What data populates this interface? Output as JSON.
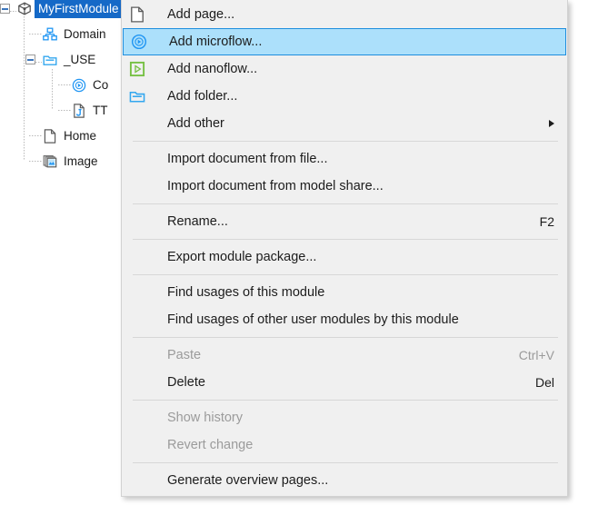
{
  "tree": {
    "items": [
      {
        "label": "MyFirstModule",
        "icon": "module-icon",
        "selected": true,
        "indent": 0,
        "expander": true
      },
      {
        "label": "Domain",
        "icon": "domain-model-icon",
        "selected": false,
        "indent": 1,
        "expander": false
      },
      {
        "label": "_USE",
        "icon": "folder-icon",
        "selected": false,
        "indent": 1,
        "expander": true
      },
      {
        "label": "Co",
        "icon": "microflow-icon",
        "selected": false,
        "indent": 2,
        "expander": false
      },
      {
        "label": "TT",
        "icon": "javascript-action-icon",
        "selected": false,
        "indent": 2,
        "expander": false
      },
      {
        "label": "Home",
        "icon": "page-icon",
        "selected": false,
        "indent": 1,
        "expander": false
      },
      {
        "label": "Image",
        "icon": "image-collection-icon",
        "selected": false,
        "indent": 1,
        "expander": false
      }
    ]
  },
  "context_menu": {
    "groups": [
      {
        "items": [
          {
            "label": "Add page...",
            "icon": "page-icon",
            "shortcut": "",
            "disabled": false,
            "highlighted": false,
            "submenu": false
          },
          {
            "label": "Add microflow...",
            "icon": "microflow-icon",
            "shortcut": "",
            "disabled": false,
            "highlighted": true,
            "submenu": false
          },
          {
            "label": "Add nanoflow...",
            "icon": "nanoflow-icon",
            "shortcut": "",
            "disabled": false,
            "highlighted": false,
            "submenu": false
          },
          {
            "label": "Add folder...",
            "icon": "folder-icon",
            "shortcut": "",
            "disabled": false,
            "highlighted": false,
            "submenu": false
          },
          {
            "label": "Add other",
            "icon": "",
            "shortcut": "",
            "disabled": false,
            "highlighted": false,
            "submenu": true
          }
        ]
      },
      {
        "items": [
          {
            "label": "Import document from file...",
            "icon": "",
            "shortcut": "",
            "disabled": false,
            "highlighted": false,
            "submenu": false
          },
          {
            "label": "Import document from model share...",
            "icon": "",
            "shortcut": "",
            "disabled": false,
            "highlighted": false,
            "submenu": false
          }
        ]
      },
      {
        "items": [
          {
            "label": "Rename...",
            "icon": "",
            "shortcut": "F2",
            "disabled": false,
            "highlighted": false,
            "submenu": false
          }
        ]
      },
      {
        "items": [
          {
            "label": "Export module package...",
            "icon": "",
            "shortcut": "",
            "disabled": false,
            "highlighted": false,
            "submenu": false
          }
        ]
      },
      {
        "items": [
          {
            "label": "Find usages of this module",
            "icon": "",
            "shortcut": "",
            "disabled": false,
            "highlighted": false,
            "submenu": false
          },
          {
            "label": "Find usages of other user modules by this module",
            "icon": "",
            "shortcut": "",
            "disabled": false,
            "highlighted": false,
            "submenu": false
          }
        ]
      },
      {
        "items": [
          {
            "label": "Paste",
            "icon": "",
            "shortcut": "Ctrl+V",
            "disabled": true,
            "highlighted": false,
            "submenu": false
          },
          {
            "label": "Delete",
            "icon": "",
            "shortcut": "Del",
            "disabled": false,
            "highlighted": false,
            "submenu": false
          }
        ]
      },
      {
        "items": [
          {
            "label": "Show history",
            "icon": "",
            "shortcut": "",
            "disabled": true,
            "highlighted": false,
            "submenu": false
          },
          {
            "label": "Revert change",
            "icon": "",
            "shortcut": "",
            "disabled": true,
            "highlighted": false,
            "submenu": false
          }
        ]
      },
      {
        "items": [
          {
            "label": "Generate overview pages...",
            "icon": "",
            "shortcut": "",
            "disabled": false,
            "highlighted": false,
            "submenu": false
          }
        ]
      }
    ]
  },
  "colors": {
    "menu_background": "#f0f0f0",
    "highlight_fill": "#ace0fb",
    "highlight_border": "#1f8ede",
    "selection_blue": "#1569c7",
    "accent_blue": "#2196f3",
    "accent_green": "#76c043",
    "disabled_text": "#9b9b9b",
    "separator": "#d7d7d7"
  }
}
